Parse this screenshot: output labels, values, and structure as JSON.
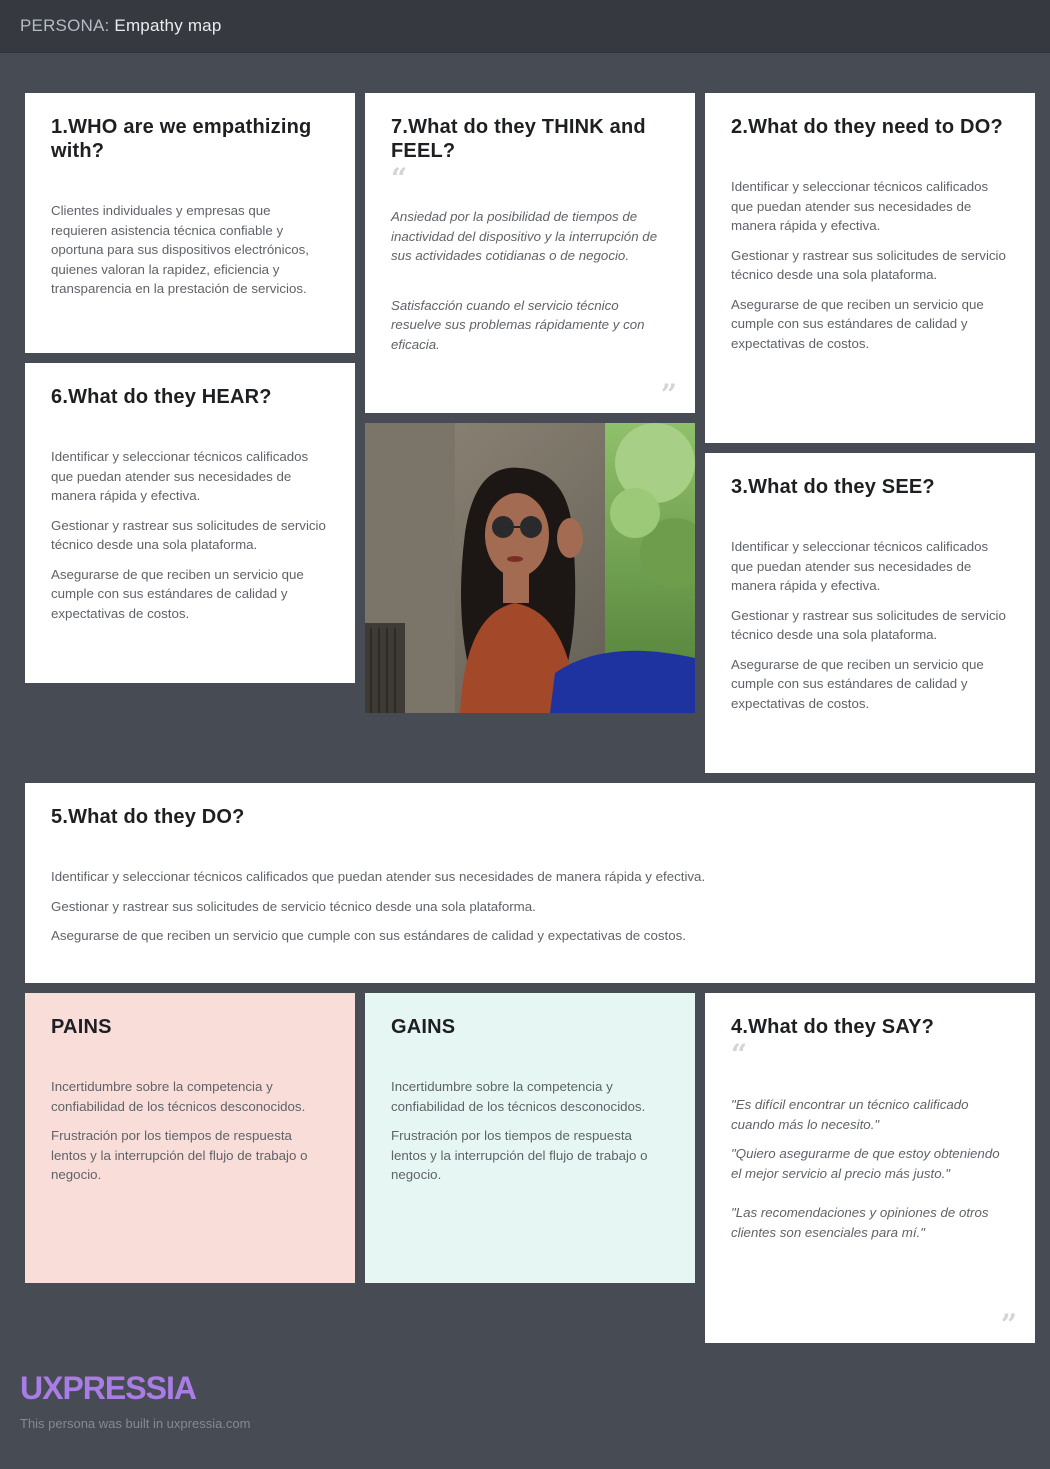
{
  "header": {
    "prefix": "PERSONA:",
    "title": "Empathy map"
  },
  "who": {
    "heading": "1.WHO are we empathizing with?",
    "text": "Clientes individuales y empresas que requieren asistencia técnica confiable y oportuna para sus dispositivos electrónicos, quienes valoran la rapidez, eficiencia y transparencia en la prestación de servicios."
  },
  "think_feel": {
    "heading": "7.What do they THINK and FEEL?",
    "items": [
      "Ansiedad por la posibilidad de tiempos de inactividad del dispositivo y la interrupción de sus actividades cotidianas o de negocio.",
      "Satisfacción cuando el servicio técnico resuelve sus problemas rápidamente y con eficacia."
    ]
  },
  "need_to_do": {
    "heading": "2.What do they need to DO?",
    "items": [
      "Identificar y seleccionar técnicos calificados que puedan atender sus necesidades de manera rápida y efectiva.",
      "Gestionar y rastrear sus solicitudes de servicio técnico desde una sola plataforma.",
      "Asegurarse de que reciben un servicio que cumple con sus estándares de calidad y expectativas de costos."
    ]
  },
  "hear": {
    "heading": "6.What do they HEAR?",
    "items": [
      "Identificar y seleccionar técnicos calificados que puedan atender sus necesidades de manera rápida y efectiva.",
      "Gestionar y rastrear sus solicitudes de servicio técnico desde una sola plataforma.",
      "Asegurarse de que reciben un servicio que cumple con sus estándares de calidad y expectativas de costos."
    ]
  },
  "see": {
    "heading": "3.What do they SEE?",
    "items": [
      "Identificar y seleccionar técnicos calificados que puedan atender sus necesidades de manera rápida y efectiva.",
      "Gestionar y rastrear sus solicitudes de servicio técnico desde una sola plataforma.",
      "Asegurarse de que reciben un servicio que cumple con sus estándares de calidad y expectativas de costos."
    ]
  },
  "do": {
    "heading": "5.What do they DO?",
    "items": [
      "Identificar y seleccionar técnicos calificados que puedan atender sus necesidades de manera rápida y efectiva.",
      "Gestionar y rastrear sus solicitudes de servicio técnico desde una sola plataforma.",
      "Asegurarse de que reciben un servicio que cumple con sus estándares de calidad y expectativas de costos."
    ]
  },
  "pains": {
    "heading": "PAINS",
    "items": [
      "Incertidumbre sobre la competencia y confiabilidad de los técnicos desconocidos.",
      "Frustración por los tiempos de respuesta lentos y la interrupción del flujo de trabajo o negocio."
    ]
  },
  "gains": {
    "heading": "GAINS",
    "items": [
      "Incertidumbre sobre la competencia y confiabilidad de los técnicos desconocidos.",
      "Frustración por los tiempos de respuesta lentos y la interrupción del flujo de trabajo o negocio."
    ]
  },
  "say": {
    "heading": "4.What do they SAY?",
    "items": [
      "\"Es difícil encontrar un técnico calificado cuando más lo necesito.\"",
      "\"Quiero asegurarme de que estoy obteniendo el mejor servicio al precio más justo.\"",
      "\"Las recomendaciones y opiniones de otros clientes son esenciales para mí.\""
    ]
  },
  "footer": {
    "brand": "UXPRESSIA",
    "note": "This persona was built in uxpressia.com"
  },
  "colors": {
    "background": "#474b53",
    "topbar": "#363940",
    "pains": "#f9ddd9",
    "gains": "#e6f7f3",
    "brand": "#a97ce6"
  }
}
